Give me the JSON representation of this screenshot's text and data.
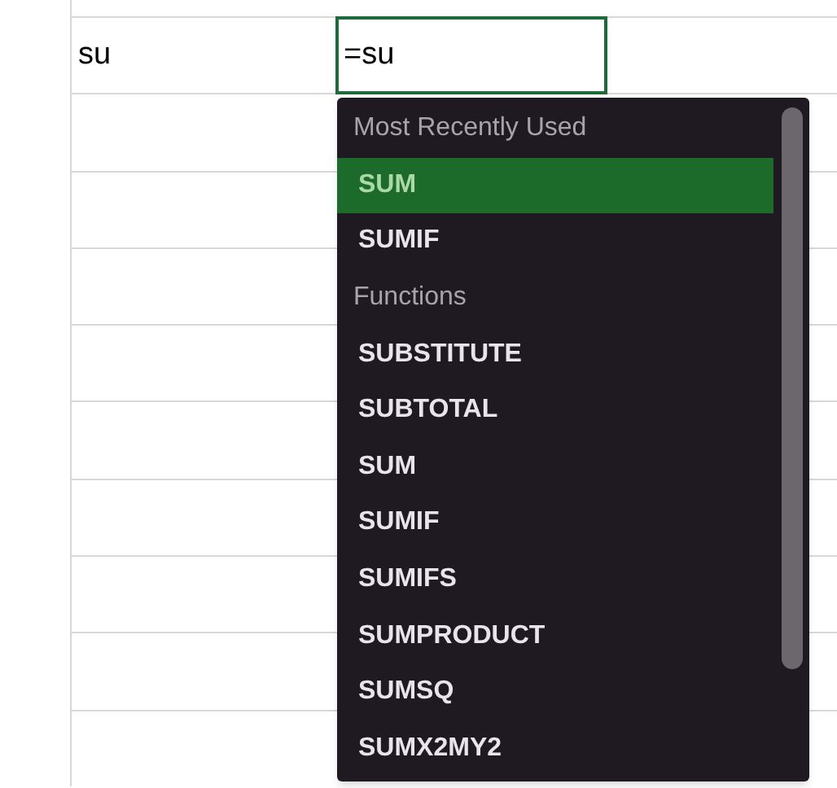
{
  "cells": [
    {
      "text": "su"
    }
  ],
  "active_cell": {
    "value": "=su"
  },
  "autocomplete": {
    "items": [
      {
        "kind": "header",
        "label": "Most Recently Used"
      },
      {
        "kind": "item",
        "label": "SUM",
        "selected": true
      },
      {
        "kind": "item",
        "label": "SUMIF",
        "selected": false
      },
      {
        "kind": "header",
        "label": "Functions"
      },
      {
        "kind": "item",
        "label": "SUBSTITUTE",
        "selected": false
      },
      {
        "kind": "item",
        "label": "SUBTOTAL",
        "selected": false
      },
      {
        "kind": "item",
        "label": "SUM",
        "selected": false
      },
      {
        "kind": "item",
        "label": "SUMIF",
        "selected": false
      },
      {
        "kind": "item",
        "label": "SUMIFS",
        "selected": false
      },
      {
        "kind": "item",
        "label": "SUMPRODUCT",
        "selected": false
      },
      {
        "kind": "item",
        "label": "SUMSQ",
        "selected": false
      },
      {
        "kind": "item",
        "label": "SUMX2MY2",
        "selected": false
      }
    ]
  }
}
